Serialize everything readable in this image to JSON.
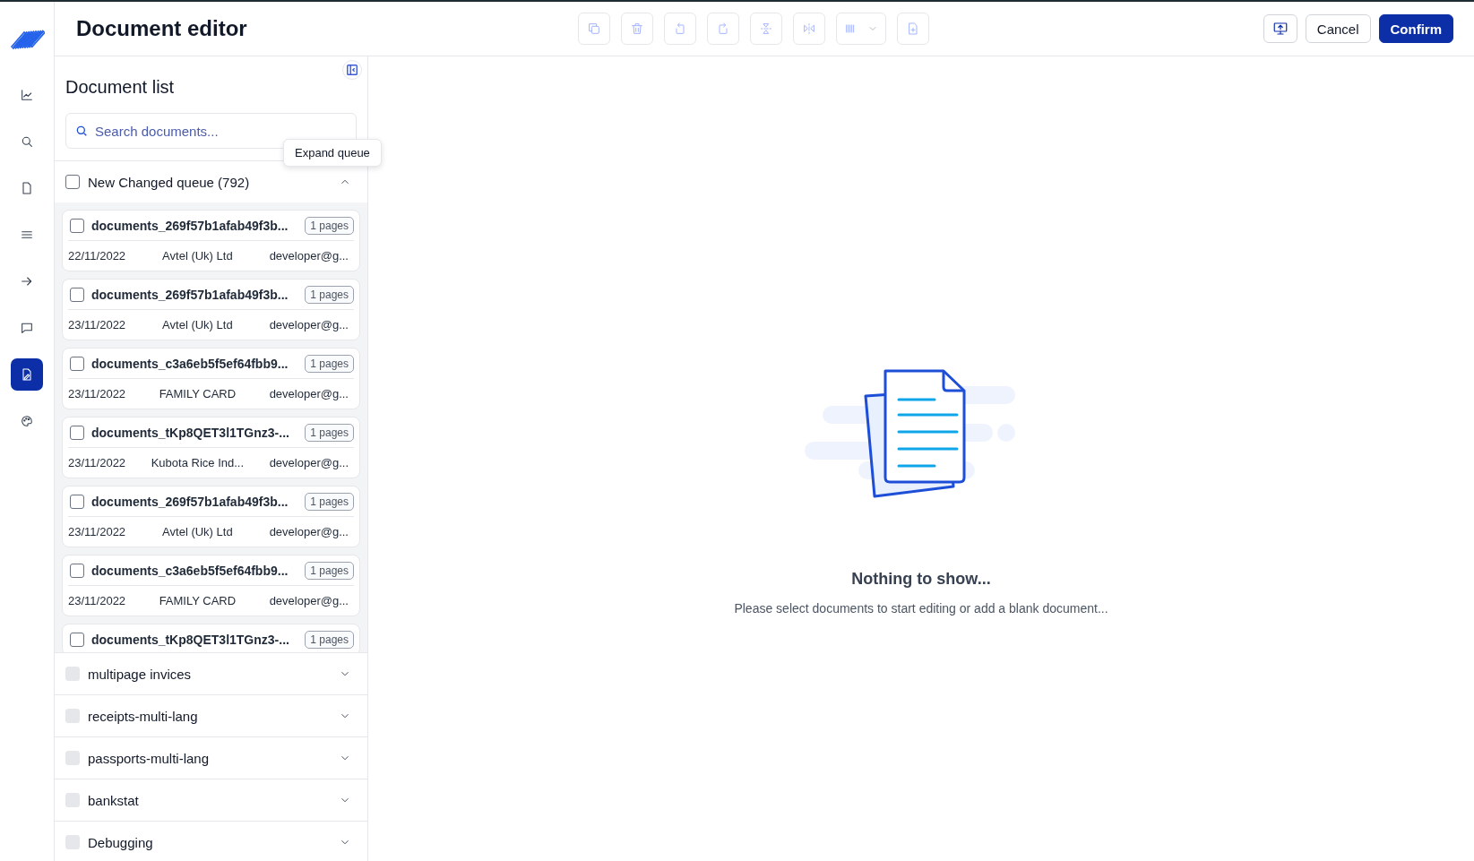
{
  "window": {
    "title": "Document editor"
  },
  "nav": [
    {
      "kind": "chart",
      "selected": false
    },
    {
      "kind": "search",
      "selected": false
    },
    {
      "kind": "file",
      "selected": false
    },
    {
      "kind": "list",
      "selected": false
    },
    {
      "kind": "arrow",
      "selected": false
    },
    {
      "kind": "chat",
      "selected": false
    },
    {
      "kind": "file-edit",
      "selected": true
    },
    {
      "kind": "palette",
      "selected": false
    }
  ],
  "toolbar": [
    {
      "kind": "copy",
      "disabled": true
    },
    {
      "kind": "trash",
      "disabled": true
    },
    {
      "kind": "rotate-left",
      "disabled": true
    },
    {
      "kind": "rotate-right",
      "disabled": true
    },
    {
      "kind": "split",
      "disabled": true
    },
    {
      "kind": "flip",
      "disabled": true
    },
    {
      "kind": "barcode",
      "disabled": true
    },
    {
      "kind": "file-plus",
      "disabled": true
    }
  ],
  "actions": [
    {
      "kind": "present"
    },
    {
      "kind": "secondary",
      "label": "Cancel"
    },
    {
      "kind": "primary",
      "label": "Confirm"
    }
  ],
  "document_list": {
    "title": "Document list",
    "search": {
      "placeholder": "Search documents..."
    },
    "tooltip": "Expand queue",
    "queues": [
      {
        "name": "New Changed queue (792)",
        "checked": false,
        "disabled": false,
        "expanded": true,
        "documents": [
          {
            "name": "documents_269f57b1afab49f3b...",
            "pages": "1 pages",
            "date": "22/11/2022",
            "company": "Avtel (Uk) Ltd",
            "owner": "developer@g...",
            "checked": false
          },
          {
            "name": "documents_269f57b1afab49f3b...",
            "pages": "1 pages",
            "date": "23/11/2022",
            "company": "Avtel (Uk) Ltd",
            "owner": "developer@g...",
            "checked": false
          },
          {
            "name": "documents_c3a6eb5f5ef64fbb9...",
            "pages": "1 pages",
            "date": "23/11/2022",
            "company": "FAMILY CARD",
            "owner": "developer@g...",
            "checked": false
          },
          {
            "name": "documents_tKp8QET3l1TGnz3-...",
            "pages": "1 pages",
            "date": "23/11/2022",
            "company": "Kubota Rice Ind...",
            "owner": "developer@g...",
            "checked": false
          },
          {
            "name": "documents_269f57b1afab49f3b...",
            "pages": "1 pages",
            "date": "23/11/2022",
            "company": "Avtel (Uk) Ltd",
            "owner": "developer@g...",
            "checked": false
          },
          {
            "name": "documents_c3a6eb5f5ef64fbb9...",
            "pages": "1 pages",
            "date": "23/11/2022",
            "company": "FAMILY CARD",
            "owner": "developer@g...",
            "checked": false
          },
          {
            "name": "documents_tKp8QET3l1TGnz3-...",
            "pages": "1 pages",
            "checked": false
          }
        ]
      },
      {
        "name": "multipage invices",
        "checked": false,
        "disabled": true,
        "expanded": false
      },
      {
        "name": "receipts-multi-lang",
        "checked": false,
        "disabled": true,
        "expanded": false
      },
      {
        "name": "passports-multi-lang",
        "checked": false,
        "disabled": true,
        "expanded": false
      },
      {
        "name": "bankstat",
        "checked": false,
        "disabled": true,
        "expanded": false
      },
      {
        "name": "Debugging",
        "checked": false,
        "disabled": true,
        "expanded": false
      }
    ]
  },
  "empty_state": {
    "title": "Nothing to show...",
    "message": "Please select documents to start editing or add a blank document..."
  }
}
